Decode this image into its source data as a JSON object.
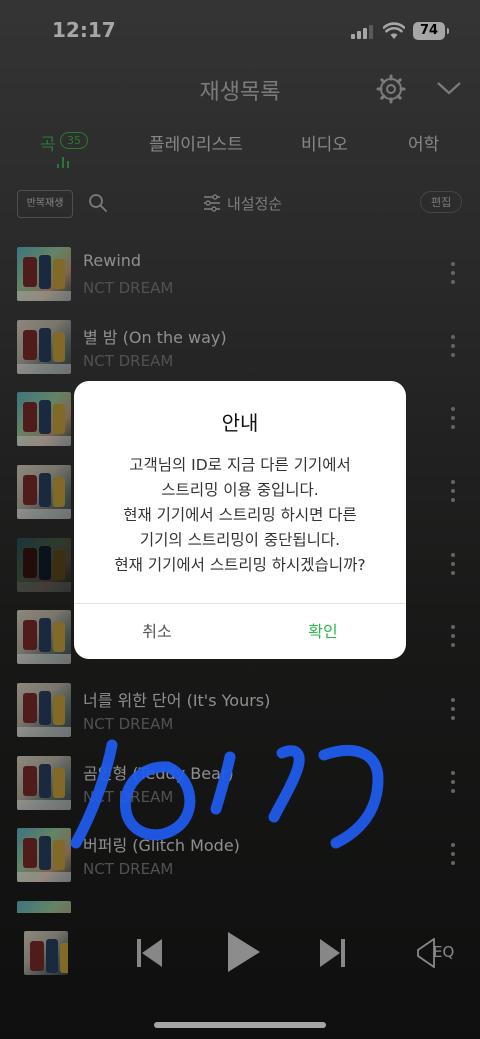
{
  "status_bar": {
    "time": "12:17",
    "battery": "74"
  },
  "header": {
    "title": "재생목록"
  },
  "tabs": {
    "song": "곡",
    "song_count": "35",
    "playlist": "플레이리스트",
    "video": "비디오",
    "language": "어학"
  },
  "toolbar": {
    "repeat_label": "반복재생",
    "sort_label": "내설정순",
    "edit_label": "편집"
  },
  "songs": [
    {
      "title": "Rewind",
      "artist": "NCT DREAM"
    },
    {
      "title": "별 밤 (On the way)",
      "artist": "NCT DREAM"
    },
    {
      "title": "",
      "artist": ""
    },
    {
      "title": "",
      "artist": ""
    },
    {
      "title": "",
      "artist": ""
    },
    {
      "title": "",
      "artist": ""
    },
    {
      "title": "너를 위한 단어 (It's Yours)",
      "artist": "NCT DREAM"
    },
    {
      "title": "곰인형 (Teddy Bear)",
      "artist": "NCT DREAM"
    },
    {
      "title": "버퍼링 (Glitch Mode)",
      "artist": "NCT DREAM"
    }
  ],
  "player": {
    "eq_label": "EQ"
  },
  "dialog": {
    "title": "안내",
    "message_lines": [
      "고객님의 ID로 지금 다른 기기에서",
      "스트리밍 이용 중입니다.",
      "현재 기기에서 스트리밍 하시면 다른",
      "기기의 스트리밍이 중단됩니다.",
      "현재 기기에서 스트리밍 하시겠습니까?"
    ],
    "cancel_label": "취소",
    "confirm_label": "확인"
  },
  "colors": {
    "accent_green": "#3fb94f",
    "confirm_green": "#2db84c",
    "scribble_blue": "#1f5cf0"
  }
}
